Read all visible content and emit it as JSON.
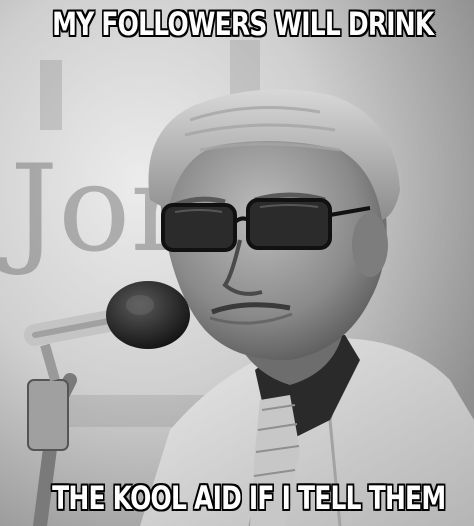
{
  "meme": {
    "top_caption": "MY FOLLOWERS WILL DRINK",
    "bottom_caption": "THE KOOL AID IF I TELL THEM"
  },
  "photo": {
    "description_icon": "man-at-microphone-photo",
    "background_sign_text": "Jon",
    "palette": {
      "light": "#e6e6e6",
      "mid": "#9a9a9a",
      "dark": "#1e1e1e"
    }
  }
}
